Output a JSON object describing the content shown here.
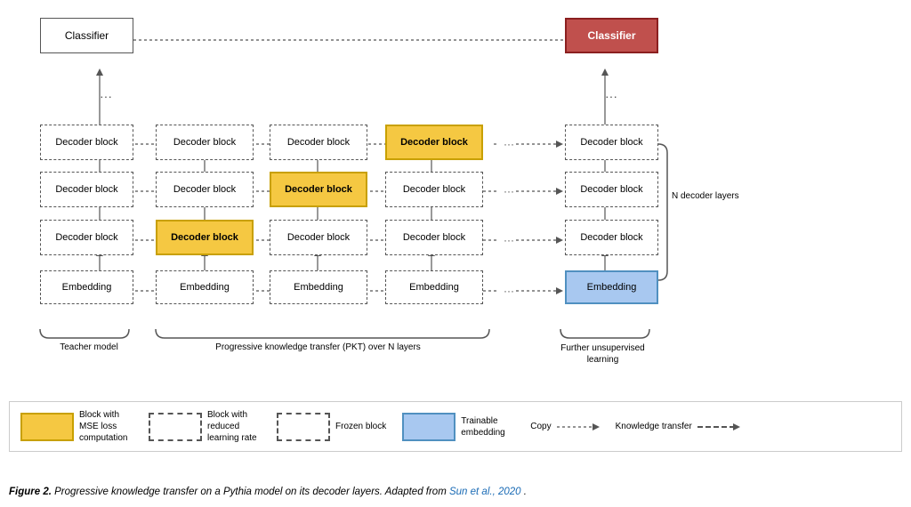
{
  "title": "Figure 2. Progressive knowledge transfer on a Pythia model on its decoder layers.",
  "citation": "Sun et al., 2020",
  "caption_prefix": "Figure 2.",
  "caption_body": " Progressive knowledge transfer on a Pythia model on its decoder layers. Adapted from ",
  "caption_suffix": ".",
  "nodes": {
    "classifier_left": {
      "label": "Classifier",
      "type": "dashed"
    },
    "classifier_right": {
      "label": "Classifier",
      "type": "red"
    },
    "ellipsis": "...",
    "decoder_block": "Decoder block",
    "embedding": "Embedding"
  },
  "legend": {
    "items": [
      {
        "type": "yellow",
        "label": "Block with MSE loss computation"
      },
      {
        "type": "reduced",
        "label": "Block with reduced learning rate"
      },
      {
        "type": "frozen",
        "label": "Frozen block"
      },
      {
        "type": "blue",
        "label": "Trainable embedding"
      },
      {
        "type": "copy_arrow",
        "label": "Copy"
      },
      {
        "type": "knowledge_arrow",
        "label": "Knowledge transfer"
      }
    ]
  },
  "labels": {
    "teacher_model": "Teacher model",
    "pkt": "Progressive knowledge transfer (PKT) over N layers",
    "further": "Further unsupervised\nlearning",
    "n_decoder": "N decoder layers"
  }
}
